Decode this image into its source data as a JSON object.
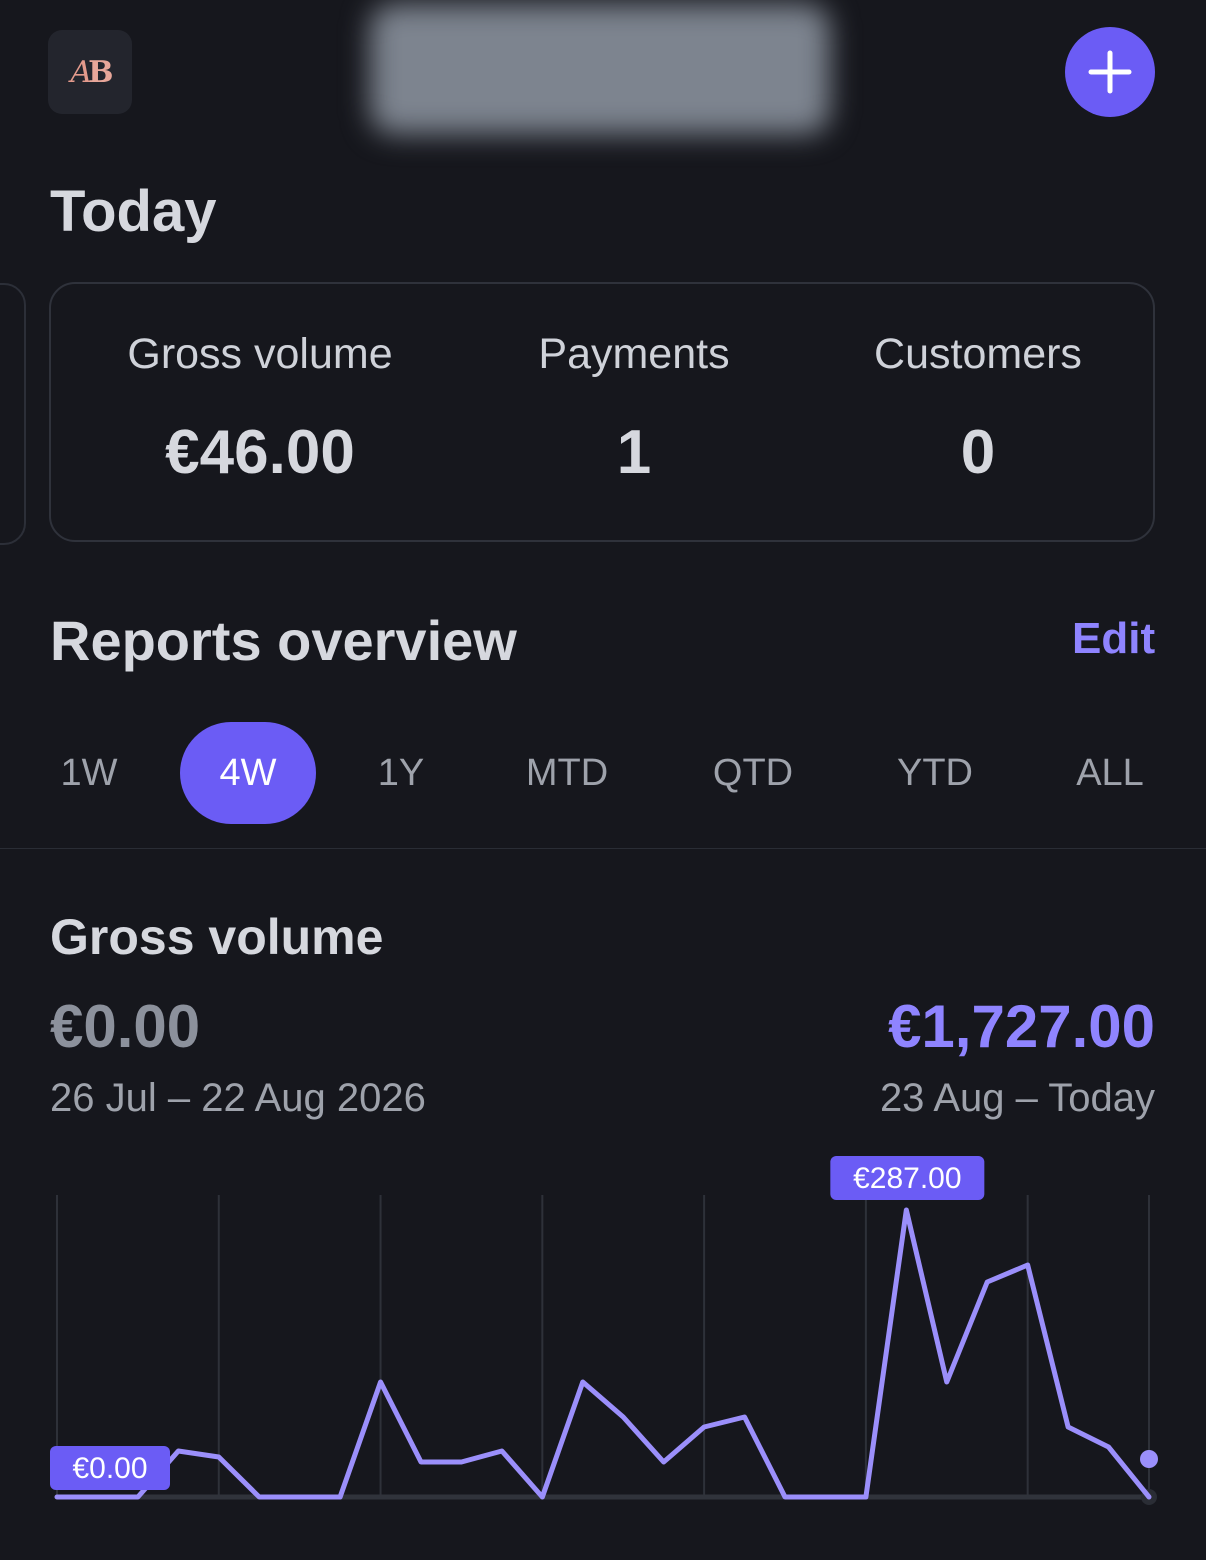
{
  "header": {
    "logo_text_a": "A",
    "logo_text_b": "B",
    "add_label": "+"
  },
  "today": {
    "title": "Today",
    "stats": [
      {
        "label": "Gross volume",
        "value": "€46.00"
      },
      {
        "label": "Payments",
        "value": "1"
      },
      {
        "label": "Customers",
        "value": "0"
      }
    ]
  },
  "reports": {
    "title": "Reports overview",
    "edit_label": "Edit",
    "tabs": [
      "1W",
      "4W",
      "1Y",
      "MTD",
      "QTD",
      "YTD",
      "ALL"
    ],
    "active_tab": "4W"
  },
  "gross_volume": {
    "title": "Gross volume",
    "previous_value": "€0.00",
    "previous_range": "26 Jul – 22 Aug 2026",
    "current_value": "€1,727.00",
    "current_range": "23 Aug – Today"
  },
  "chart_data": {
    "type": "line",
    "x": [
      1,
      2,
      3,
      4,
      5,
      6,
      7,
      8,
      9,
      10,
      11,
      12,
      13,
      14,
      15,
      16,
      17,
      18,
      19,
      20,
      21,
      22,
      23,
      24,
      25,
      26,
      27,
      28
    ],
    "values": [
      0,
      0,
      0,
      46,
      40,
      0,
      0,
      0,
      115,
      35,
      35,
      46,
      0,
      115,
      80,
      35,
      70,
      80,
      0,
      0,
      0,
      287,
      115,
      215,
      232,
      70,
      50,
      0
    ],
    "ylim": [
      0,
      287
    ],
    "max_label": "€287.00",
    "min_label": "€0.00",
    "colors": {
      "line": "#9b8ffb",
      "badge": "#6b5cf5",
      "grid": "#2e3139",
      "baseline": "#30333b"
    },
    "grid": true
  }
}
